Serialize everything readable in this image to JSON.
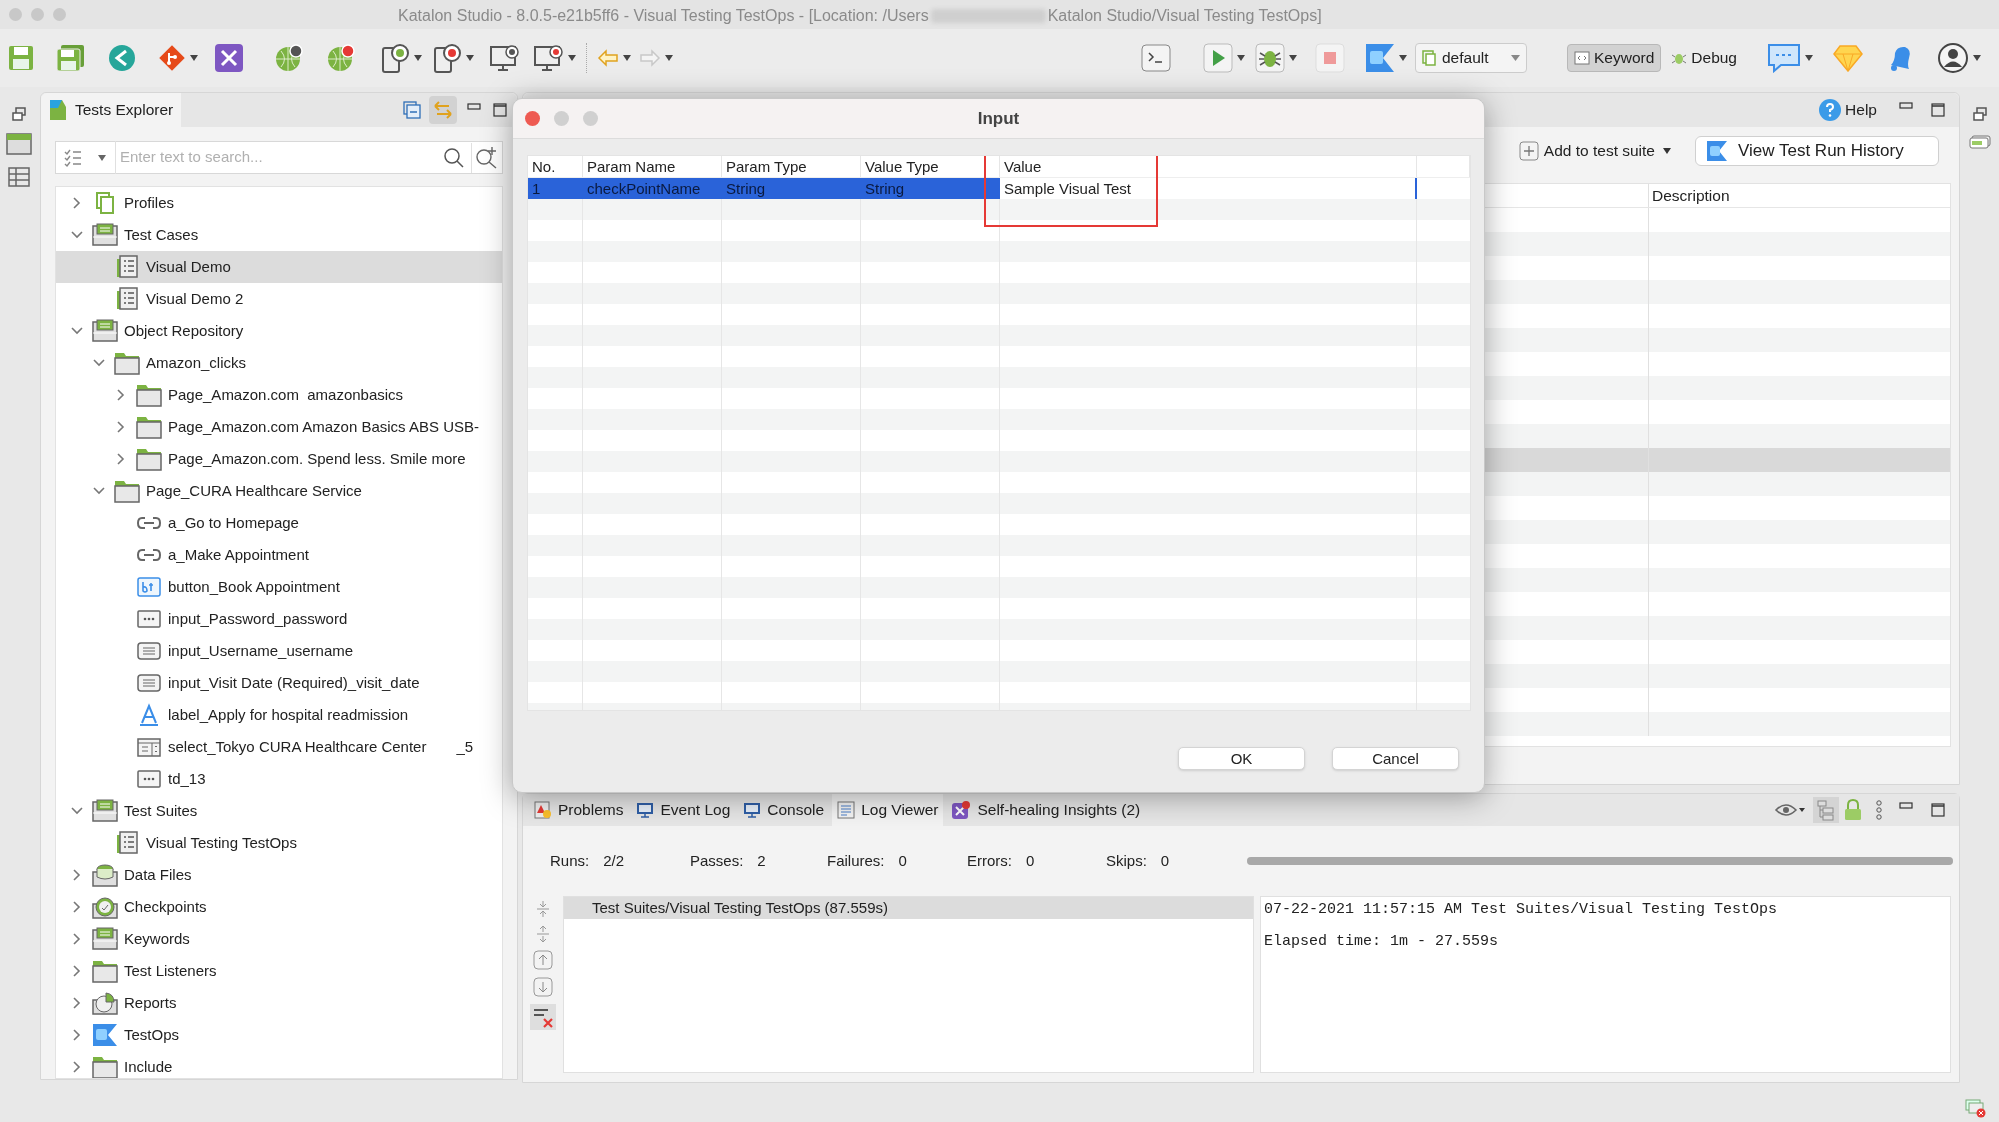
{
  "window": {
    "title_start": "Katalon Studio - 8.0.5-e21b5ff6 - Visual Testing TestOps - [Location: /Users",
    "title_end": "Katalon Studio/Visual Testing TestOps]"
  },
  "toolbar": {
    "profile": "default",
    "keyword_button": {
      "label": "Keyword",
      "pressed": true
    },
    "debug_button": "Debug"
  },
  "tests_explorer": {
    "title": "Tests Explorer",
    "search": {
      "placeholder": "Enter text to search..."
    },
    "tree": [
      {
        "label": "Profiles",
        "kind": "profiles",
        "expanded": false,
        "selected": false
      },
      {
        "label": "Test Cases",
        "kind": "test-cases",
        "expanded": true,
        "selected": false,
        "children": [
          {
            "label": "Visual Demo",
            "kind": "test-case",
            "selected": true
          },
          {
            "label": "Visual Demo 2",
            "kind": "test-case",
            "selected": false
          }
        ]
      },
      {
        "label": "Object Repository",
        "kind": "repository",
        "expanded": true,
        "selected": false,
        "children": [
          {
            "label": "Amazon_clicks",
            "kind": "folder",
            "expanded": true,
            "selected": false,
            "children": [
              {
                "label": "Page_Amazon.com  amazonbasics",
                "kind": "folder",
                "expanded": false,
                "selected": false
              },
              {
                "label": "Page_Amazon.com Amazon Basics ABS USB-",
                "kind": "folder",
                "expanded": false,
                "selected": false
              },
              {
                "label": "Page_Amazon.com. Spend less. Smile more",
                "kind": "folder",
                "expanded": false,
                "selected": false
              }
            ]
          },
          {
            "label": "Page_CURA Healthcare Service",
            "kind": "folder",
            "expanded": true,
            "selected": false,
            "children": [
              {
                "label": "a_Go to Homepage",
                "kind": "link",
                "selected": false
              },
              {
                "label": "a_Make Appointment",
                "kind": "link",
                "selected": false
              },
              {
                "label": "button_Book Appointment",
                "kind": "button",
                "selected": false
              },
              {
                "label": "input_Password_password",
                "kind": "element",
                "selected": false
              },
              {
                "label": "input_Username_username",
                "kind": "text-input",
                "selected": false
              },
              {
                "label": "input_Visit Date (Required)_visit_date",
                "kind": "text-input",
                "selected": false
              },
              {
                "label": "label_Apply for hospital readmission",
                "kind": "label",
                "selected": false
              },
              {
                "label": "select_Tokyo CURA Healthcare Center",
                "tail": "_5",
                "kind": "select",
                "selected": false
              },
              {
                "label": "td_13",
                "kind": "element",
                "selected": false
              }
            ]
          }
        ]
      },
      {
        "label": "Test Suites",
        "kind": "test-suites",
        "expanded": true,
        "selected": false,
        "children": [
          {
            "label": "Visual Testing TestOps",
            "kind": "test-case",
            "selected": false
          }
        ]
      },
      {
        "label": "Data Files",
        "kind": "data-files",
        "expanded": false,
        "selected": false
      },
      {
        "label": "Checkpoints",
        "kind": "checkpoints",
        "expanded": false,
        "selected": false
      },
      {
        "label": "Keywords",
        "kind": "keywords",
        "expanded": false,
        "selected": false
      },
      {
        "label": "Test Listeners",
        "kind": "folder",
        "expanded": false,
        "selected": false
      },
      {
        "label": "Reports",
        "kind": "reports",
        "expanded": false,
        "selected": false
      },
      {
        "label": "TestOps",
        "kind": "testops",
        "expanded": false,
        "selected": false
      },
      {
        "label": "Include",
        "kind": "folder",
        "expanded": false,
        "selected": false
      }
    ]
  },
  "editor": {
    "help": "Help",
    "add_to_suite": "Add to test suite",
    "history_button": "View Test Run History",
    "table": {
      "columns": [
        "Description"
      ],
      "rows": [
        {
          "selected": false
        },
        {
          "selected": false
        },
        {
          "selected": false
        },
        {
          "selected": false
        },
        {
          "selected": false
        },
        {
          "selected": false
        },
        {
          "selected": false
        },
        {
          "selected": false
        },
        {
          "selected": false
        },
        {
          "selected": false
        },
        {
          "selected": true
        },
        {
          "selected": false
        },
        {
          "selected": false
        },
        {
          "selected": false
        },
        {
          "selected": false
        },
        {
          "selected": false
        },
        {
          "selected": false
        },
        {
          "selected": false
        },
        {
          "selected": false
        },
        {
          "selected": false
        },
        {
          "selected": false
        },
        {
          "selected": false
        }
      ]
    }
  },
  "dialog": {
    "title": "Input",
    "columns": [
      "No.",
      "Param Name",
      "Param Type",
      "Value Type",
      "Value"
    ],
    "rows": [
      {
        "cells": [
          "1",
          "checkPointName",
          "String",
          "String",
          "Sample Visual Test"
        ],
        "selected": true
      }
    ],
    "buttons": [
      "OK",
      "Cancel"
    ]
  },
  "bottom_panel": {
    "tabs": [
      {
        "label": "Problems",
        "kind": "problems",
        "selected": false
      },
      {
        "label": "Event Log",
        "kind": "monitor",
        "selected": false
      },
      {
        "label": "Console",
        "kind": "monitor",
        "selected": false
      },
      {
        "label": "Log Viewer",
        "kind": "log",
        "selected": true
      },
      {
        "label": "Self-healing Insights (2)",
        "kind": "healing",
        "selected": false
      }
    ],
    "stats": [
      {
        "label": "Runs:",
        "value": "2/2"
      },
      {
        "label": "Passes:",
        "value": "2"
      },
      {
        "label": "Failures:",
        "value": "0"
      },
      {
        "label": "Errors:",
        "value": "0"
      },
      {
        "label": "Skips:",
        "value": "0"
      }
    ],
    "progress": {
      "level": 1
    },
    "log_tree": [
      {
        "label": "Test Suites/Visual Testing TestOps (87.559s)",
        "selected": true
      }
    ],
    "log_lines": [
      "07-22-2021 11:57:15 AM Test Suites/Visual Testing TestOps",
      "Elapsed time: 1m - 27.559s"
    ]
  }
}
